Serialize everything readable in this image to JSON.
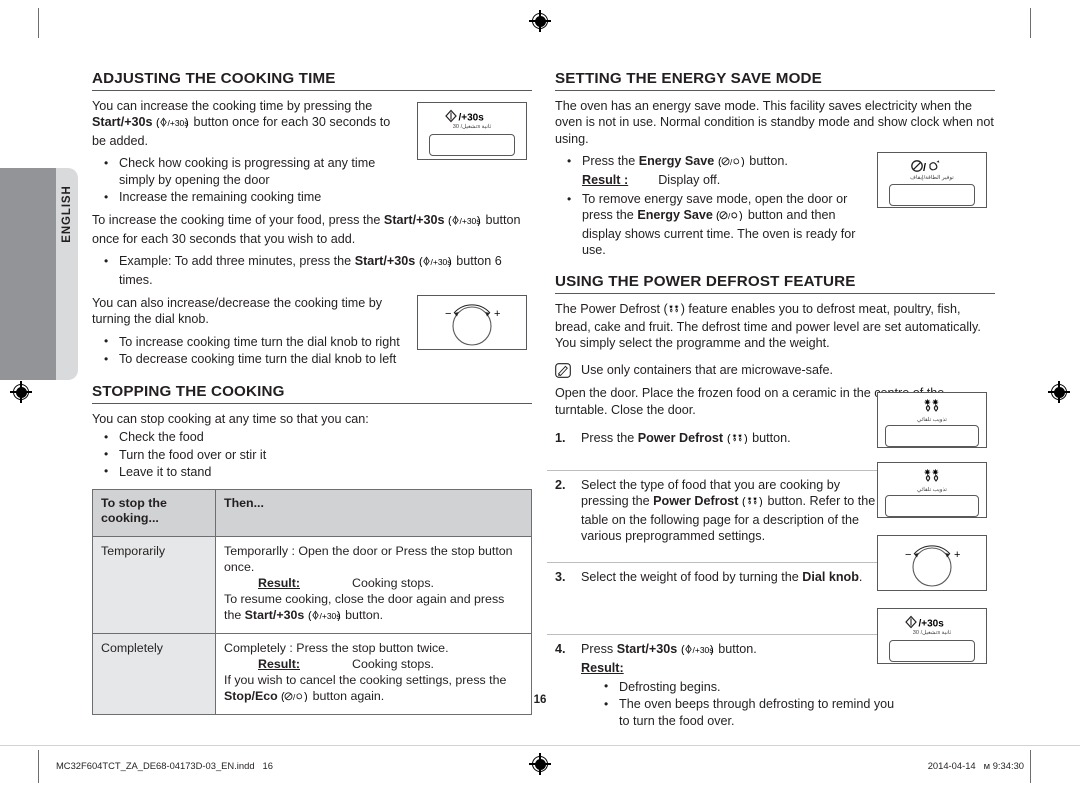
{
  "document": {
    "page_number": "16",
    "language_tab": "ENGLISH"
  },
  "left_column": {
    "section1": {
      "heading": "ADJUSTING THE COOKING TIME",
      "intro_a": "You can increase the cooking time by pressing the ",
      "intro_b": "Start/+30s",
      "intro_c": " button once for each 30 seconds to be added.",
      "bullets": [
        "Check how cooking is progressing at any time simply by opening the door",
        "Increase the remaining cooking time"
      ],
      "para2_a": "To increase the cooking time of your food, press the ",
      "para2_b": "Start/+30s",
      "para2_c": " button once for each 30 seconds that you wish to add.",
      "example_a": "Example: To add three minutes, press the ",
      "example_b": "Start/+30s",
      "example_c": " button 6 times.",
      "para3": "You can also increase/decrease the cooking time by turning the dial knob.",
      "bullets2": [
        "To increase cooking time turn the dial knob to right",
        "To decrease cooking time turn the dial knob to left"
      ]
    },
    "section2": {
      "heading": "STOPPING THE COOKING",
      "intro": "You can stop cooking at any time so that you can:",
      "bullets": [
        "Check the food",
        "Turn the food over or stir it",
        "Leave it to stand"
      ],
      "table": {
        "headers": [
          "To stop the cooking...",
          "Then..."
        ],
        "rows": [
          {
            "label": "Temporarily",
            "line1": "Temporarlly : Open the door or Press the stop button once.",
            "result_label": "Result:",
            "result_value": "Cooking stops.",
            "line2_a": "To resume cooking, close the door again and press the ",
            "line2_b": "Start/+30s",
            "line2_c": " button."
          },
          {
            "label": "Completely",
            "line1": "Completely : Press the stop button twice.",
            "result_label": "Result:",
            "result_value": "Cooking stops.",
            "line2_a": "If you wish to cancel the cooking settings, press the ",
            "line2_b": "Stop/Eco",
            "line2_c": " button again."
          }
        ]
      }
    }
  },
  "right_column": {
    "section1": {
      "heading": "SETTING THE ENERGY SAVE MODE",
      "para1": "The oven has an energy save mode. This facility saves electricity when the oven is not in use. Normal condition is standby mode and show clock when not using.",
      "bullet1_a": "Press the ",
      "bullet1_b": "Energy Save",
      "bullet1_c": " button.",
      "result_label": "Result :",
      "result_value": "Display off.",
      "bullet2_a": "To remove energy save mode, open the door or press the ",
      "bullet2_b": "Energy Save",
      "bullet2_c": " button and then display shows current time. The oven is ready for use."
    },
    "section2": {
      "heading": "USING THE POWER DEFROST FEATURE",
      "para1_a": "The Power Defrost (",
      "para1_b": ") feature enables you to defrost meat, poultry, fish, bread, cake and fruit. The defrost time and power level are set automatically. You simply select the programme and the weight.",
      "note": "Use only containers that are microwave-safe.",
      "para2": "Open the door. Place the frozen food on a ceramic in the centre of the turntable. Close the door.",
      "steps": [
        {
          "num": "1.",
          "text_a": "Press the ",
          "text_b": "Power Defrost",
          "text_c": " button."
        },
        {
          "num": "2.",
          "text_a": "Select the type of food that you are cooking by pressing the ",
          "text_b": "Power Defrost",
          "text_c": " button. Refer to the table on the following page for a description of the various preprogrammed settings."
        },
        {
          "num": "3.",
          "text_a": "Select the weight of food by turning the ",
          "text_b": "Dial knob",
          "text_c": "."
        },
        {
          "num": "4.",
          "text_a": "Press ",
          "text_b": "Start/+30s",
          "text_c": " button.",
          "result_label": "Result:",
          "result_bullets": [
            "Defrosting begins.",
            "The oven beeps through defrosting to remind you to turn the food over."
          ]
        }
      ]
    }
  },
  "illustrations": {
    "start30s": {
      "caption_main": "/+30s",
      "caption_arabic": "تشغيل/ 30s ثانية"
    },
    "energy_save": {
      "caption_main": "/",
      "caption_arabic": "توفير الطاقة/إيقاف"
    },
    "power_defrost": {
      "caption_arabic": "تذويب تلقائي"
    },
    "dial_knob": {
      "minus": "−",
      "plus": "+"
    }
  },
  "footer": {
    "file_name": "MC32F604TCT_ZA_DE68-04173D-03_EN.indd",
    "file_page": "16",
    "date": "2014-04-14",
    "time_prefix": "ᴍ",
    "time": "9:34:30"
  }
}
